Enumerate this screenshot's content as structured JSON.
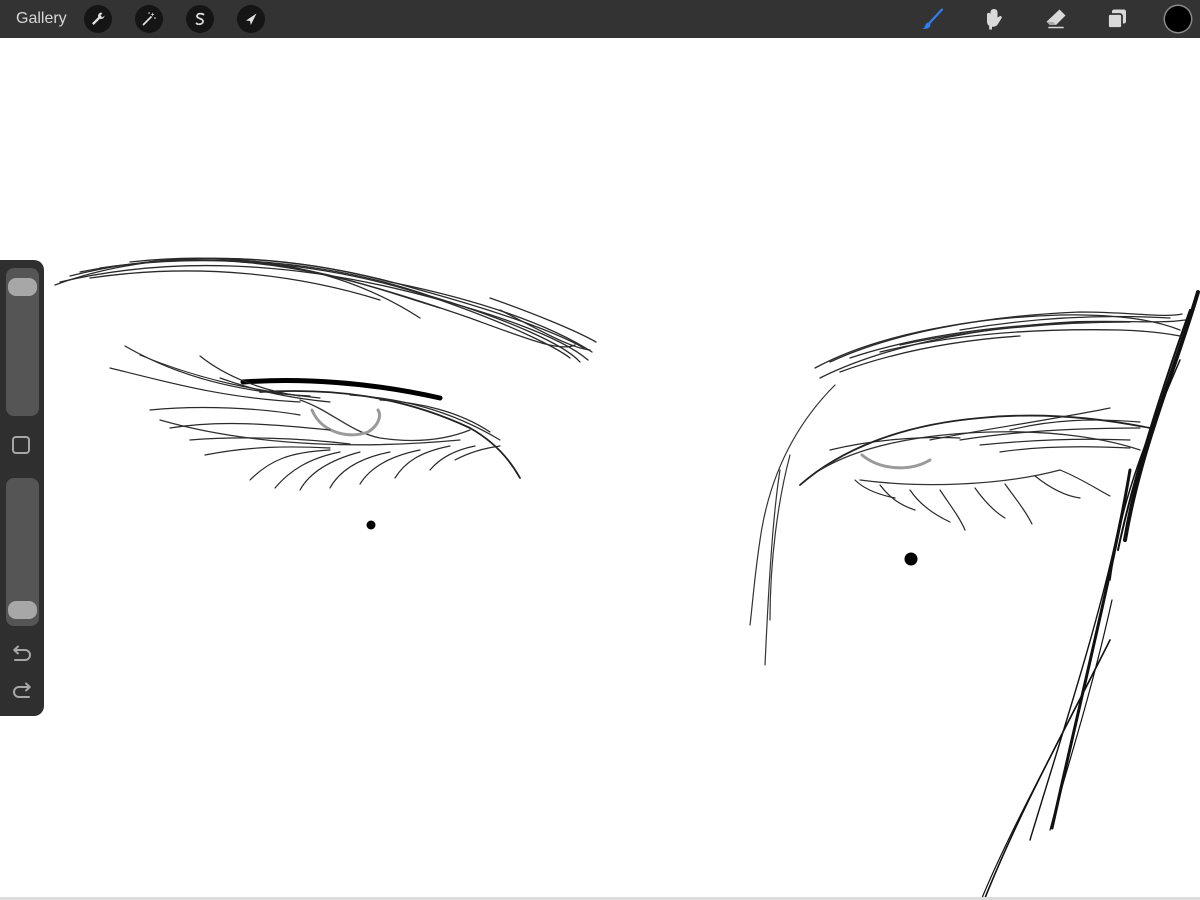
{
  "topbar": {
    "gallery_label": "Gallery",
    "left_tools": [
      "wrench-icon",
      "magic-wand-icon",
      "selection-s-icon",
      "transform-arrow-icon"
    ],
    "right_tools": [
      "brush-icon",
      "smudge-icon",
      "eraser-icon",
      "layers-icon"
    ],
    "active_tool": "brush-icon",
    "current_color": "#000000",
    "brush_active_color": "#2f7ff0"
  },
  "sidebar": {
    "size_slider_level": 0.94,
    "opacity_slider_level": 0.04,
    "icons": [
      "modify-square-icon",
      "undo-icon",
      "redo-icon"
    ]
  },
  "canvas": {
    "background": "#ffffff",
    "stroke_color": "#1a1a1a",
    "iris_color": "#9a9a9a"
  }
}
